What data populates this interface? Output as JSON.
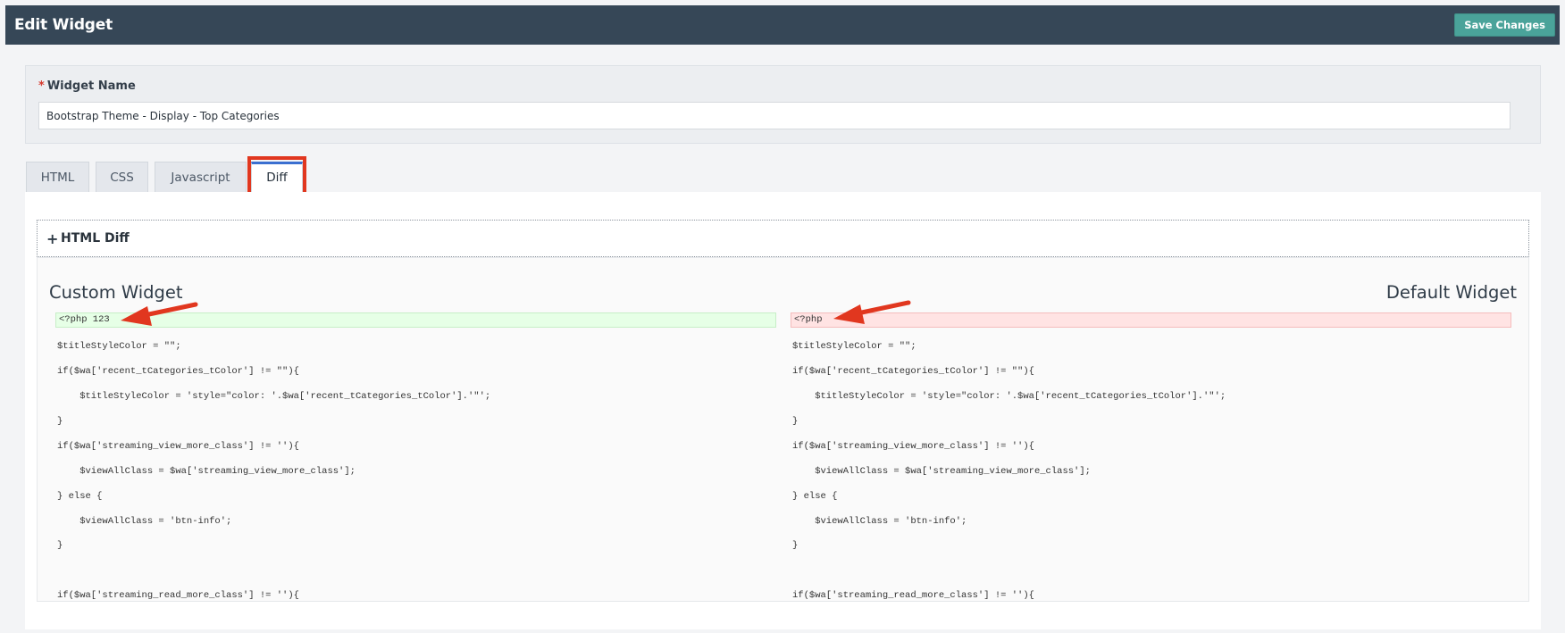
{
  "header": {
    "title": "Edit Widget",
    "save_label": "Save Changes"
  },
  "widget_name": {
    "label": "Widget Name",
    "required_mark": "*",
    "value": "Bootstrap Theme - Display - Top Categories"
  },
  "tabs": [
    {
      "label": "HTML"
    },
    {
      "label": "CSS"
    },
    {
      "label": "Javascript"
    },
    {
      "label": "Diff",
      "active": true
    }
  ],
  "accordion": {
    "icon": "plus-icon",
    "title": "HTML Diff"
  },
  "diff": {
    "left_title": "Custom Widget",
    "right_title": "Default Widget",
    "left_first": "<?php 123",
    "right_first": "<?php",
    "lines": [
      "$titleStyleColor = \"\";",
      "if($wa['recent_tCategories_tColor'] != \"\"){",
      "    $titleStyleColor = 'style=\"color: '.$wa['recent_tCategories_tColor'].'\"';",
      "}",
      "if($wa['streaming_view_more_class'] != ''){",
      "    $viewAllClass = $wa['streaming_view_more_class'];",
      "} else {",
      "    $viewAllClass = 'btn-info';",
      "}",
      "if($wa['streaming_read_more_class'] != ''){"
    ]
  },
  "colors": {
    "topbar": "#364757",
    "save_button": "#4aa39a",
    "added": "#e6ffe6",
    "removed": "#ffe3e3",
    "annotation": "#e1371f"
  }
}
